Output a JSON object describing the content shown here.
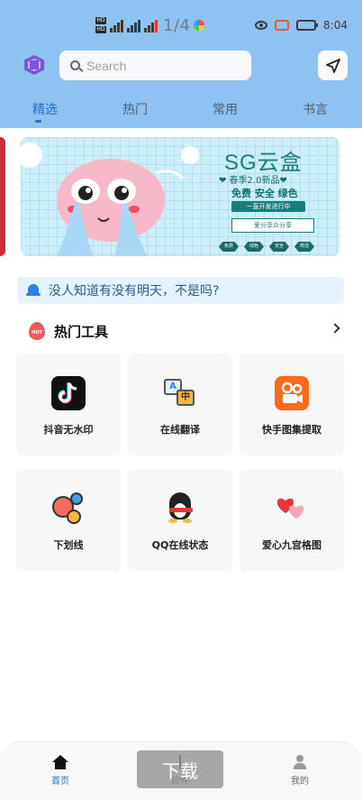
{
  "statusbar": {
    "page_indicator": "1/4",
    "time": "8:04",
    "sim1": "HD",
    "sim2": "HD"
  },
  "header": {
    "search_placeholder": "Search",
    "tabs": [
      {
        "label": "精选",
        "active": true
      },
      {
        "label": "热门",
        "active": false
      },
      {
        "label": "常用",
        "active": false
      },
      {
        "label": "书言",
        "active": false
      }
    ]
  },
  "banner": {
    "title": "SG云盒",
    "line1": "❤ 春季2.0新品❤",
    "line2": "免费 安全 绿色",
    "line3": "一直开发进行中",
    "quote": "爱分享众分享",
    "tags": [
      "免费",
      "绿色",
      "安全",
      "简洁"
    ],
    "accent_color": "#1a7d79"
  },
  "notice": {
    "text": "没人知道有没有明天，不是吗?"
  },
  "section": {
    "hot_badge": "HOT",
    "title": "热门工具"
  },
  "tools": [
    {
      "label": "抖音无水印",
      "icon": "tiktok-icon"
    },
    {
      "label": "在线翻译",
      "icon": "translate-icon"
    },
    {
      "label": "快手图集提取",
      "icon": "kuaishou-icon"
    },
    {
      "label": "下划线",
      "icon": "underline-icon"
    },
    {
      "label": "QQ在线状态",
      "icon": "qq-penguin-icon"
    },
    {
      "label": "爱心九宫格图",
      "icon": "heart-icon"
    }
  ],
  "translate_icon": {
    "a": "A",
    "b": "中"
  },
  "bottom_nav": [
    {
      "label": "首页",
      "icon": "home-icon",
      "active": true
    },
    {
      "label": "软件",
      "icon": "apps-icon",
      "active": false
    },
    {
      "label": "我的",
      "icon": "user-icon",
      "active": false
    }
  ],
  "toast": {
    "text": "下载"
  },
  "colors": {
    "header_bg": "#8ec3f1",
    "accent": "#1e6fd0",
    "notice_bg": "#e6f3fe"
  }
}
